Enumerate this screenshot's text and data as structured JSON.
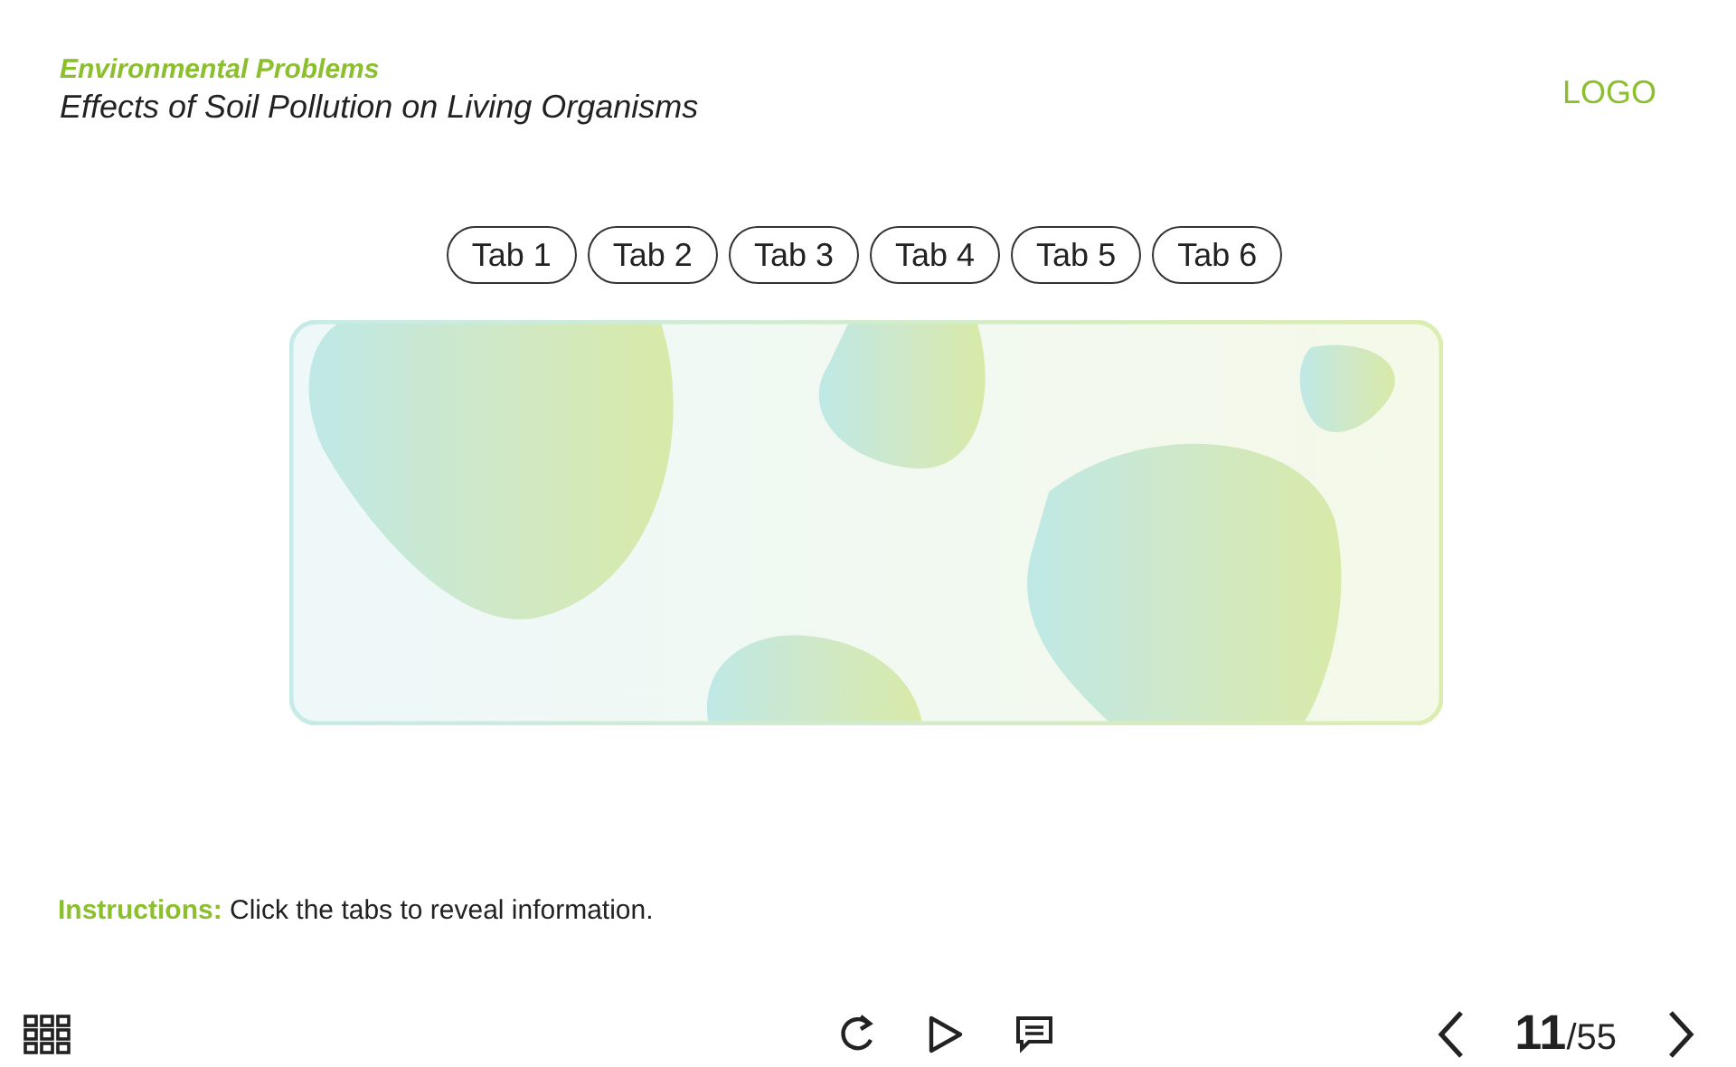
{
  "header": {
    "section": "Environmental Problems",
    "title": "Effects of Soil Pollution on Living Organisms",
    "logo": "LOGO"
  },
  "tabs": [
    {
      "label": "Tab 1",
      "selected": false
    },
    {
      "label": "Tab 2",
      "selected": false
    },
    {
      "label": "Tab 3",
      "selected": false
    },
    {
      "label": "Tab 4",
      "selected": false
    },
    {
      "label": "Tab 5",
      "selected": false
    },
    {
      "label": "Tab 6",
      "selected": false
    }
  ],
  "instructions": "**Instructions:** Click the tabs to reveal information.",
  "footer": {
    "page_counter": "**11**/55"
  }
}
